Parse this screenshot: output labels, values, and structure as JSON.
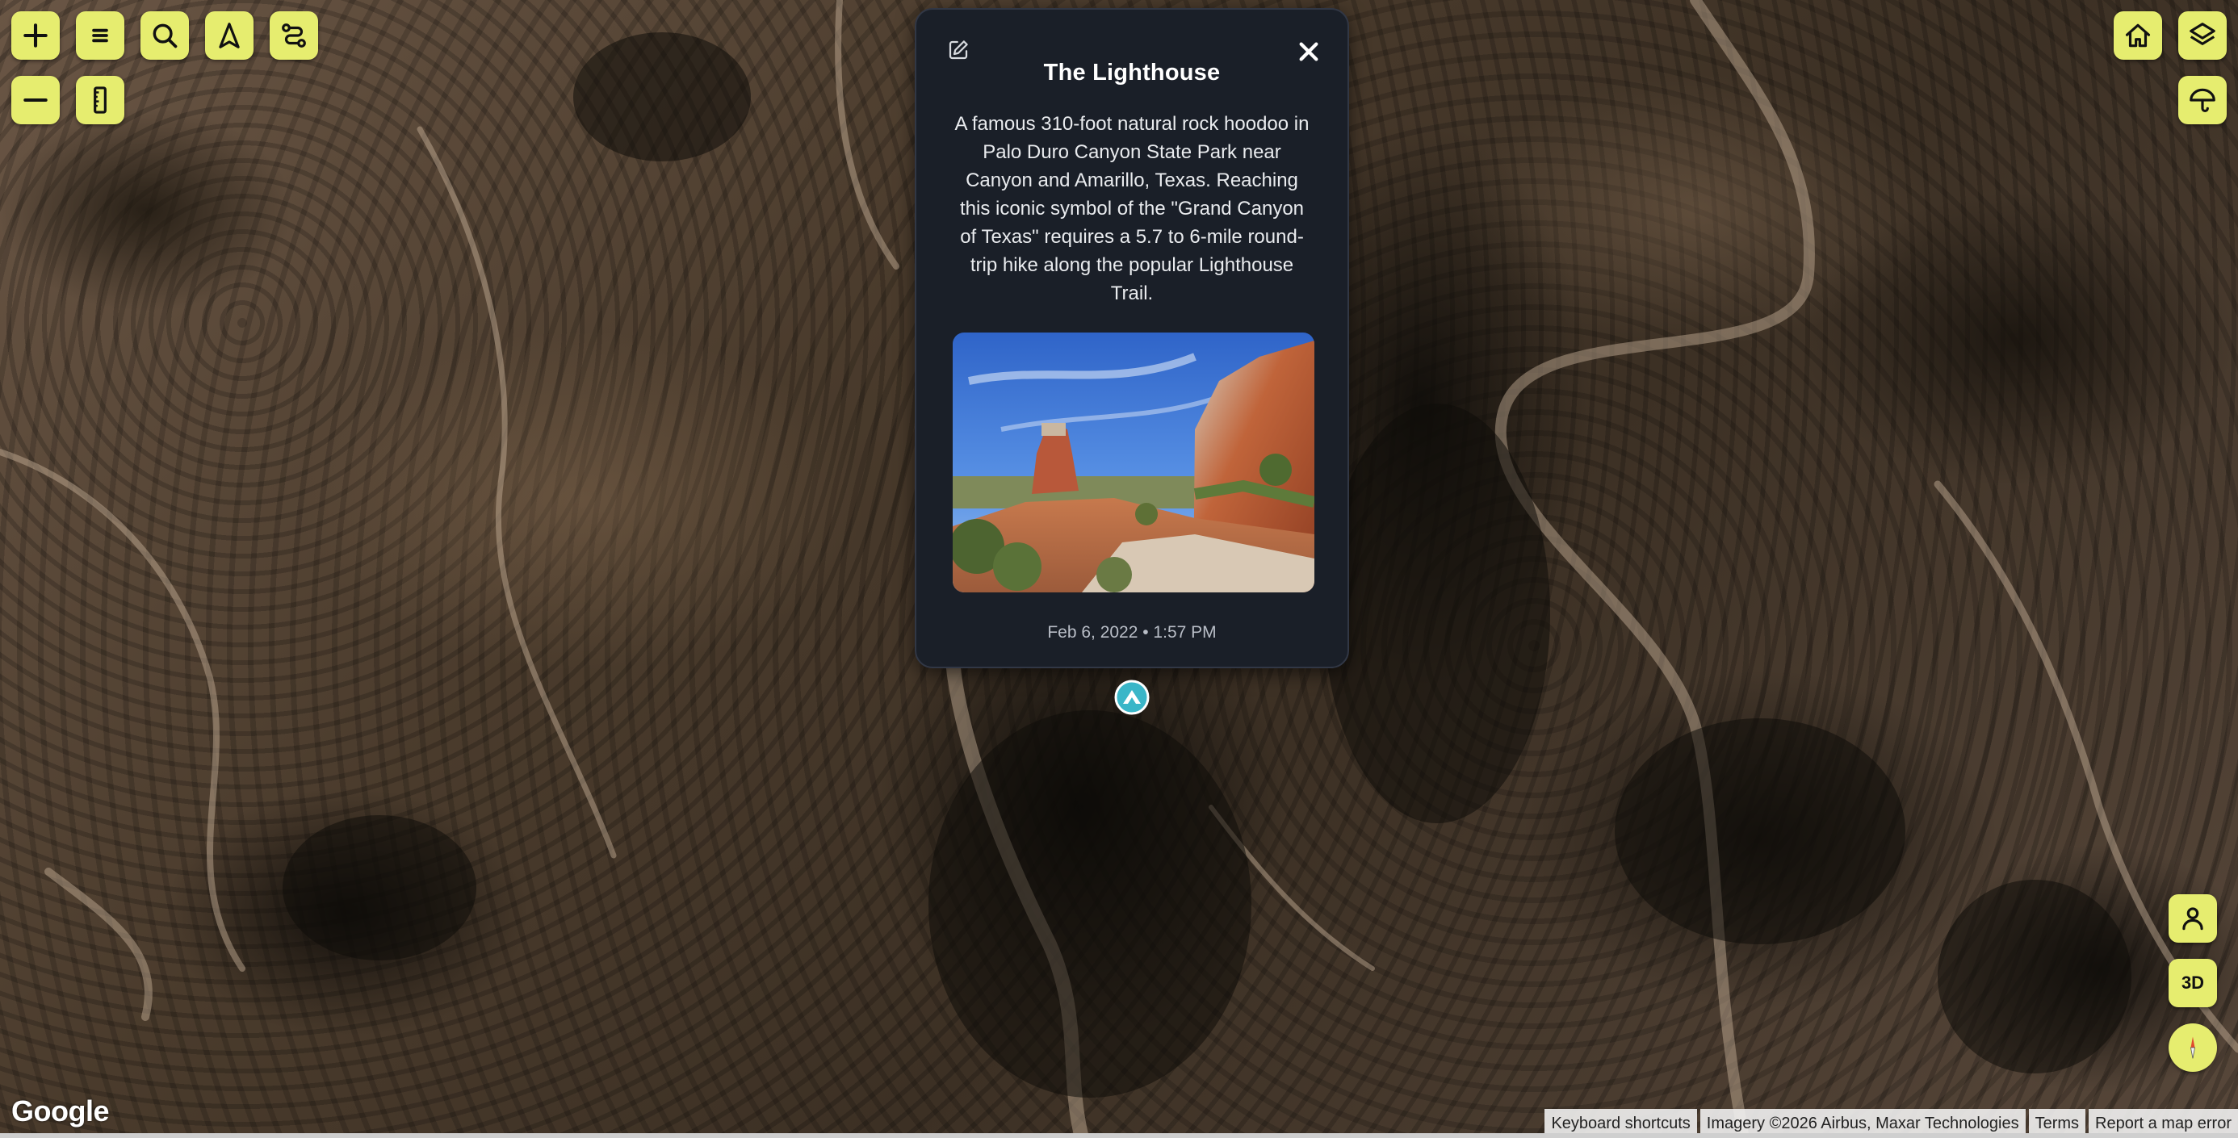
{
  "popup": {
    "title": "The Lighthouse",
    "description": "A famous 310-foot natural rock hoodoo in Palo Duro Canyon State Park near Canyon and Amarillo, Texas. Reaching this iconic symbol of the \"Grand Canyon of Texas\" requires a 5.7 to 6-mile round-trip hike along the popular Lighthouse Trail.",
    "timestamp": "Feb 6, 2022 • 1:57 PM"
  },
  "controls": {
    "zoom_in_icon": "plus-icon",
    "menu_icon": "menu-icon",
    "search_icon": "search-icon",
    "navigate_icon": "navigation-arrow-icon",
    "route_icon": "route-icon",
    "zoom_out_icon": "minus-icon",
    "measure_icon": "ruler-icon",
    "home_icon": "home-icon",
    "layers_icon": "layers-icon",
    "weather_icon": "umbrella-icon",
    "street_view_icon": "person-icon",
    "three_d_label": "3D",
    "compass_icon": "compass-icon"
  },
  "map": {
    "logo": "Google",
    "attribution": {
      "keyboard_shortcuts": "Keyboard shortcuts",
      "imagery": "Imagery ©2026 Airbus, Maxar Technologies",
      "terms": "Terms",
      "report": "Report a map error"
    }
  },
  "colors": {
    "control_accent": "#e6ed6f",
    "popup_background": "#1a1f28",
    "marker": "#3ab6c8"
  }
}
